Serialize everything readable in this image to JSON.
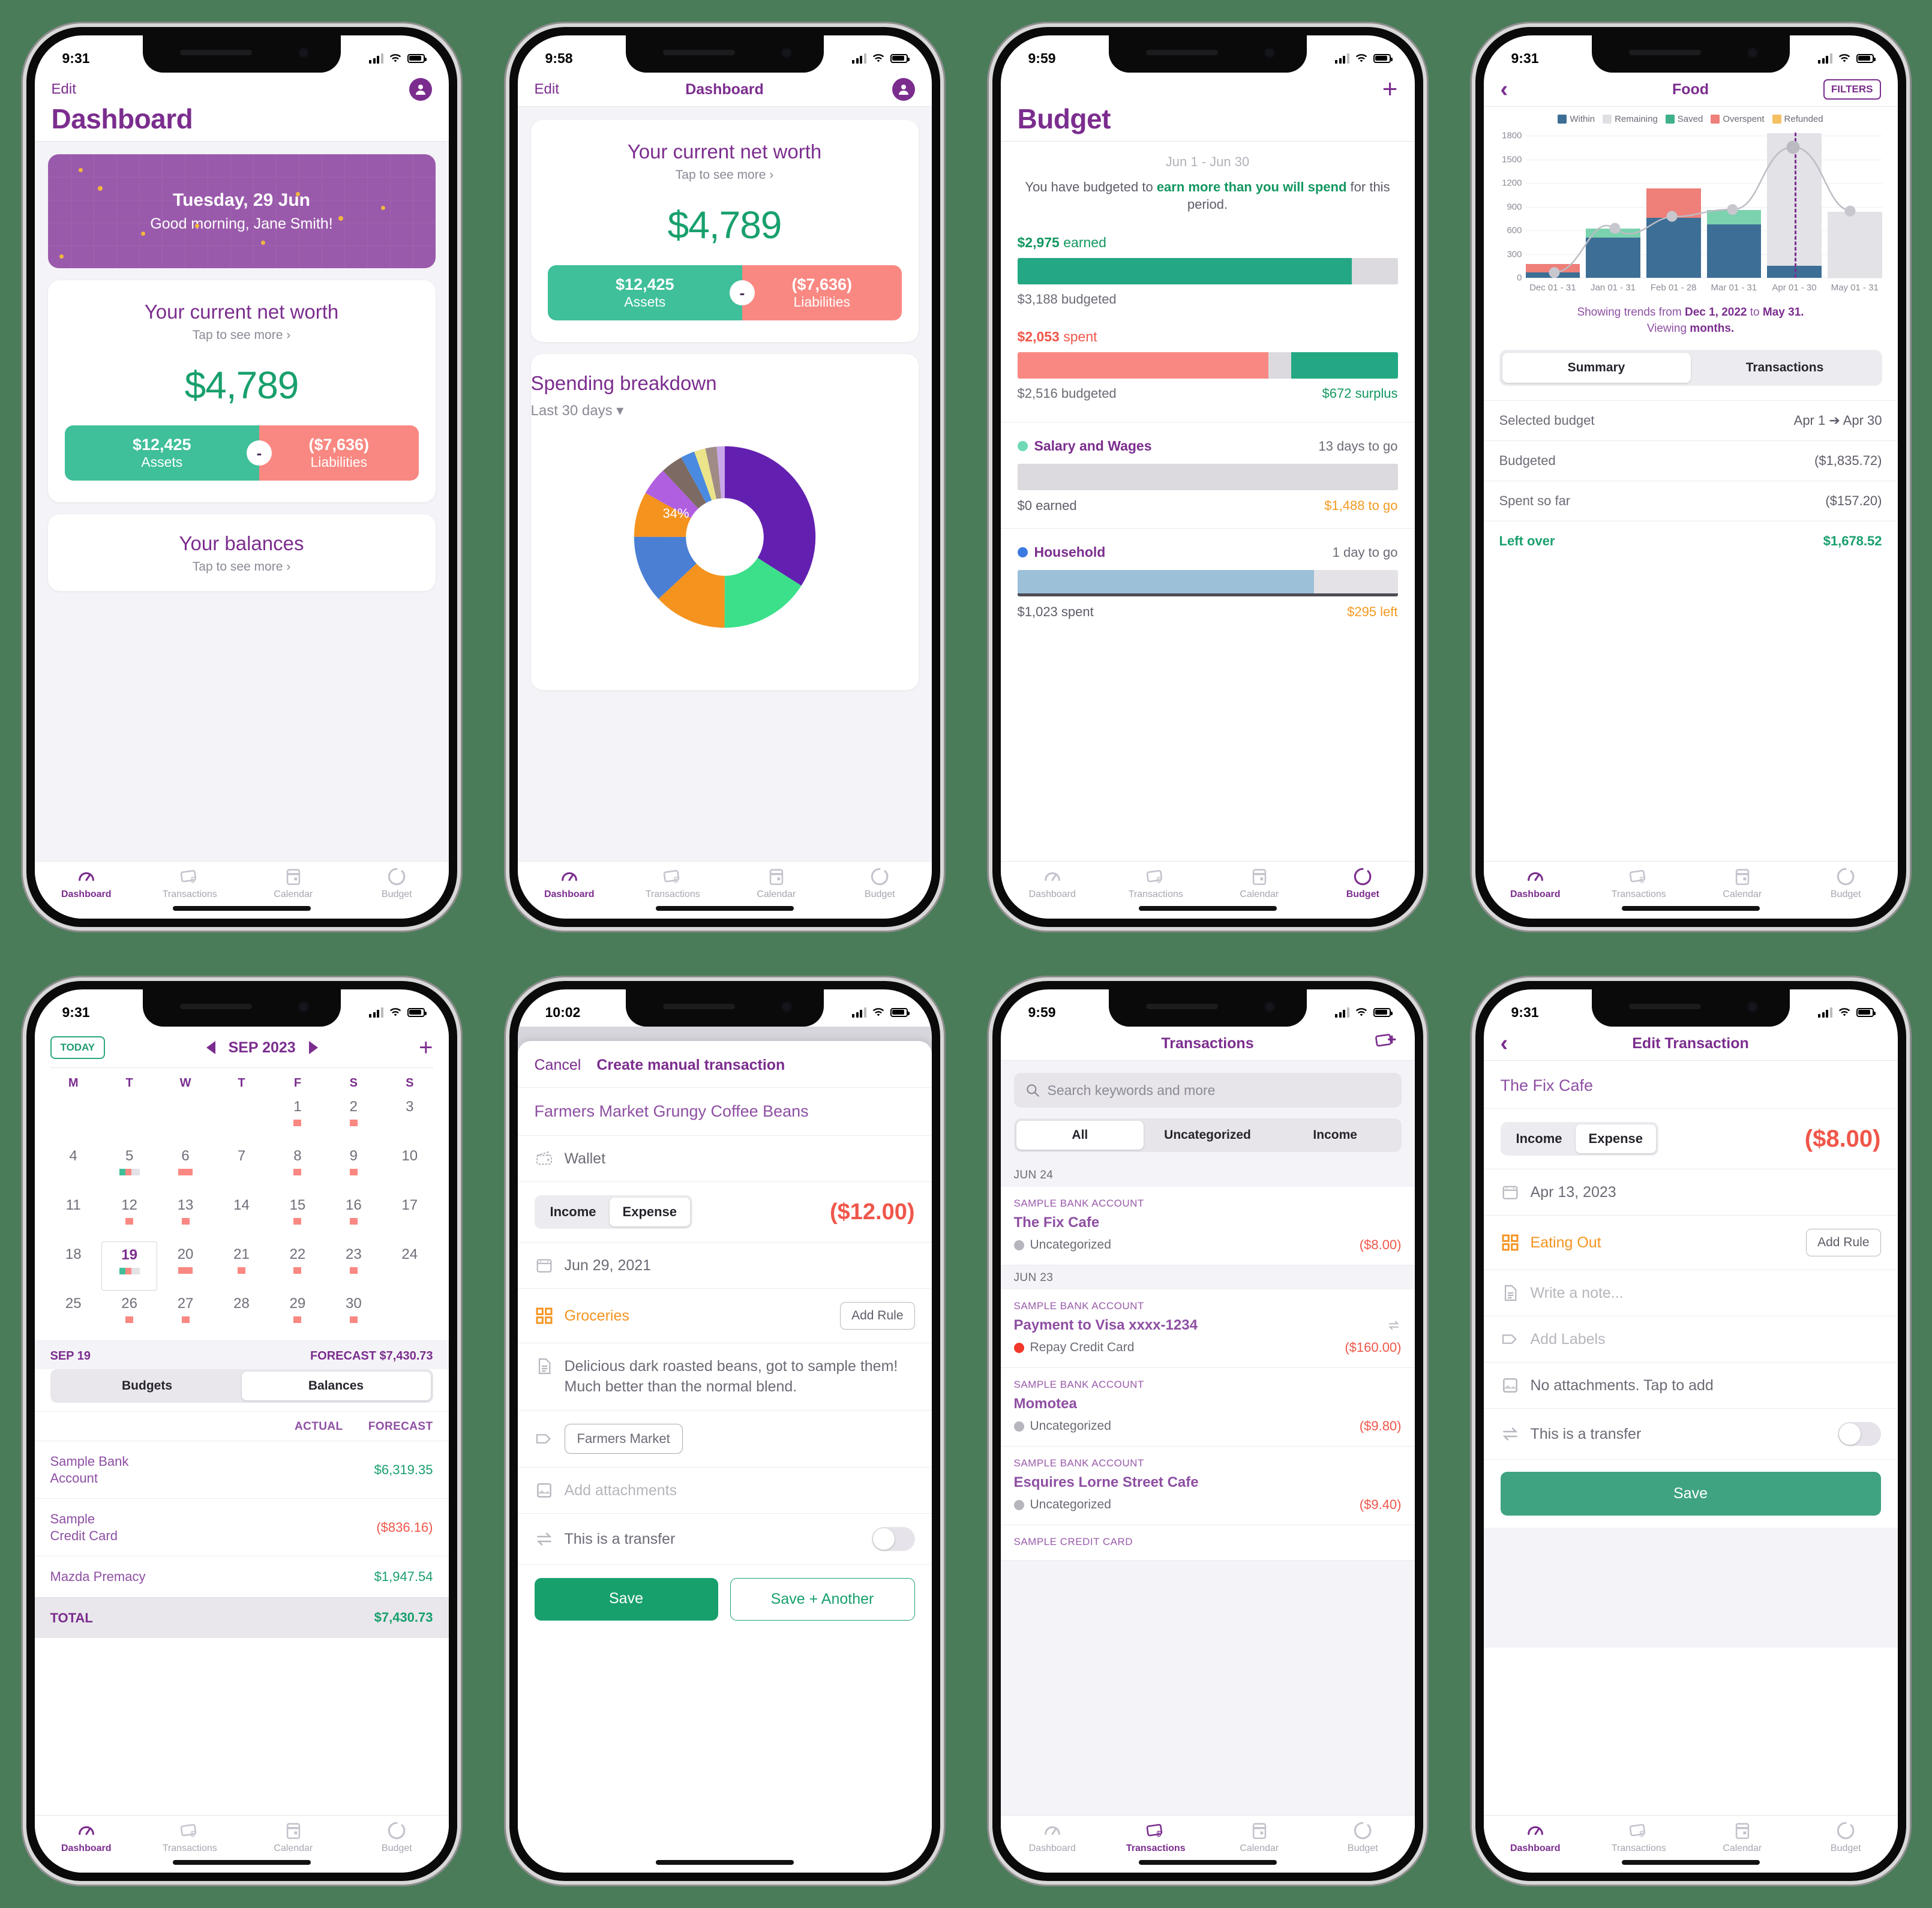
{
  "colors": {
    "purple": "#7b2d8e",
    "purple_light": "#9a5aab",
    "green": "#18a06c",
    "teal": "#3fbf9a",
    "red": "#f0564a",
    "salmon": "#f98882",
    "amber": "#f49a22",
    "orange": "#f5931f",
    "blue": "#4a7fd4",
    "steel": "#3d6e96"
  },
  "tabbar": {
    "items": [
      {
        "label": "Dashboard",
        "icon": "speedometer-icon"
      },
      {
        "label": "Transactions",
        "icon": "card-money-icon"
      },
      {
        "label": "Calendar",
        "icon": "calendar-icon"
      },
      {
        "label": "Budget",
        "icon": "donut-icon"
      }
    ]
  },
  "screen1": {
    "status": {
      "time": "9:31"
    },
    "nav": {
      "left": "Edit",
      "avatar": "avatar-icon"
    },
    "title": "Dashboard",
    "greeting": {
      "date": "Tuesday, 29 Jun",
      "message": "Good morning, Jane Smith!"
    },
    "networth": {
      "title": "Your current net worth",
      "subtitle": "Tap to see more ›",
      "amount": "$4,789",
      "assets_value": "$12,425",
      "assets_label": "Assets",
      "liabilities_value": "($7,636)",
      "liabilities_label": "Liabilities",
      "operator": "-"
    },
    "balances": {
      "title": "Your balances",
      "subtitle": "Tap to see more ›"
    },
    "active_tab": 0
  },
  "screen2": {
    "status": {
      "time": "9:58"
    },
    "nav": {
      "left": "Edit",
      "title": "Dashboard",
      "avatar": "avatar-icon"
    },
    "networth": {
      "title": "Your current net worth",
      "subtitle": "Tap to see more ›",
      "amount": "$4,789",
      "assets_value": "$12,425",
      "assets_label": "Assets",
      "liabilities_value": "($7,636)",
      "liabilities_label": "Liabilities",
      "operator": "-"
    },
    "spending": {
      "title": "Spending breakdown",
      "range": "Last 30 days ▾"
    },
    "active_tab": 0,
    "chart_data": {
      "type": "pie",
      "title": "Spending breakdown",
      "subtitle": "Last 30 days",
      "labels": [
        "34%",
        "13%",
        "12%",
        "8%",
        "5%",
        "",
        "",
        "",
        "",
        "",
        ""
      ],
      "values": [
        34,
        13,
        12,
        8,
        5,
        4,
        3,
        2,
        2,
        1,
        16
      ],
      "colors": [
        "#6320b0",
        "#f5931f",
        "#4a7fd4",
        "#f5931f",
        "#b05fe0",
        "#7d6a62",
        "#4a8ae0",
        "#ebe48a",
        "#a08b86",
        "#f0a860",
        "#3de08a"
      ],
      "legend": "none",
      "grid": false
    }
  },
  "screen3": {
    "status": {
      "time": "9:59"
    },
    "nav": {
      "right": "+"
    },
    "title": "Budget",
    "period": "Jun 1 - Jun 30",
    "message_pre": "You have budgeted to ",
    "message_bold": "earn more than you will spend",
    "message_post": " for this period.",
    "earned": {
      "label_amount": "$2,975",
      "label_word": " earned",
      "budgeted": "$3,188 budgeted",
      "pct": 88
    },
    "spent": {
      "label_amount": "$2,053",
      "label_word": " spent",
      "budgeted": "$2,516 budgeted",
      "surplus": "$672 surplus",
      "pct": 66,
      "surplus_pct": 28
    },
    "categories": [
      {
        "name": "Salary and Wages",
        "dot": "#6fd9b4",
        "days": "13 days to go",
        "progress": 0,
        "bar_color": "#dcdade",
        "left_text": "$0 earned",
        "right_text": "$1,488 to go",
        "right_amber": true
      },
      {
        "name": "Household",
        "dot": "#3b7ae0",
        "days": "1 day to go",
        "progress": 78,
        "bar_color": "#9cc0d8",
        "left_text": "$1,023 spent",
        "right_text": "$295 left",
        "right_amber": true
      }
    ],
    "active_tab": 3
  },
  "screen4": {
    "status": {
      "time": "9:31"
    },
    "nav": {
      "back": "‹",
      "title": "Food",
      "filters": "FILTERS"
    },
    "trend_pre": "Showing trends from ",
    "trend_b1": "Dec 1, 2022",
    "trend_mid": " to ",
    "trend_b2": "May 31.",
    "trend_post2": "Viewing ",
    "trend_b3": "months.",
    "segments": [
      {
        "label": "Summary",
        "active": true
      },
      {
        "label": "Transactions",
        "active": false
      }
    ],
    "summary_rows": [
      {
        "key": "Selected budget",
        "value": "Apr 1 ➔ Apr 30",
        "highlight": false
      },
      {
        "key": "Budgeted",
        "value": "($1,835.72)",
        "highlight": false
      },
      {
        "key": "Spent so far",
        "value": "($157.20)",
        "highlight": false
      },
      {
        "key": "Left over",
        "value": "$1,678.52",
        "highlight": true
      }
    ],
    "active_tab": 0,
    "chart_data": {
      "type": "bar",
      "title": "Food",
      "categories": [
        "Dec 01 - 31",
        "Jan 01 - 31",
        "Feb 01 - 28",
        "Mar 01 - 31",
        "Apr 01 - 30",
        "May 01 - 31"
      ],
      "ylim": [
        0,
        1900
      ],
      "yticks": [
        0,
        300,
        600,
        900,
        1200,
        1500,
        1800
      ],
      "grid": true,
      "legend_position": "top",
      "legend": [
        "Within",
        "Remaining",
        "Saved",
        "Overspent",
        "Refunded"
      ],
      "legend_colors": [
        "#3d6e96",
        "#dfdfe4",
        "#3fb08a",
        "#ee7f79",
        "#f4c064"
      ],
      "series": [
        {
          "name": "Within",
          "values": [
            70,
            510,
            760,
            680,
            150,
            0
          ]
        },
        {
          "name": "Remaining",
          "values": [
            0,
            0,
            0,
            0,
            1680,
            840
          ]
        },
        {
          "name": "Saved",
          "values": [
            0,
            115,
            0,
            180,
            0,
            0
          ]
        },
        {
          "name": "Overspent",
          "values": [
            105,
            0,
            370,
            0,
            0,
            0
          ]
        },
        {
          "name": "Refunded",
          "values": [
            0,
            0,
            0,
            0,
            0,
            0
          ]
        }
      ],
      "line_series": {
        "name": "Trend",
        "values": [
          70,
          625,
          775,
          865,
          1830,
          845
        ]
      },
      "marker_line_index": 4
    }
  },
  "screen5": {
    "status": {
      "time": "9:31"
    },
    "today_button": "TODAY",
    "month": "SEP 2023",
    "add": "+",
    "dow": [
      "M",
      "T",
      "W",
      "T",
      "F",
      "S",
      "S"
    ],
    "weeks": [
      [
        {
          "n": ""
        },
        {
          "n": ""
        },
        {
          "n": ""
        },
        {
          "n": ""
        },
        {
          "n": "1",
          "mark": "red"
        },
        {
          "n": "2",
          "mark": "red"
        },
        {
          "n": "3"
        }
      ],
      [
        {
          "n": "4"
        },
        {
          "n": "5",
          "mark": "split"
        },
        {
          "n": "6",
          "mark": "redwide"
        },
        {
          "n": "7"
        },
        {
          "n": "8",
          "mark": "red"
        },
        {
          "n": "9",
          "mark": "red"
        },
        {
          "n": "10"
        }
      ],
      [
        {
          "n": "11"
        },
        {
          "n": "12",
          "mark": "red"
        },
        {
          "n": "13",
          "mark": "red"
        },
        {
          "n": "14"
        },
        {
          "n": "15",
          "mark": "red"
        },
        {
          "n": "16",
          "mark": "red"
        },
        {
          "n": "17"
        }
      ],
      [
        {
          "n": "18"
        },
        {
          "n": "19",
          "mark": "split",
          "selected": true
        },
        {
          "n": "20",
          "mark": "redwide"
        },
        {
          "n": "21",
          "mark": "red"
        },
        {
          "n": "22",
          "mark": "red"
        },
        {
          "n": "23",
          "mark": "red"
        },
        {
          "n": "24"
        }
      ],
      [
        {
          "n": "25"
        },
        {
          "n": "26",
          "mark": "red"
        },
        {
          "n": "27",
          "mark": "red"
        },
        {
          "n": "28"
        },
        {
          "n": "29",
          "mark": "red"
        },
        {
          "n": "30",
          "mark": "red"
        },
        {
          "n": ""
        }
      ]
    ],
    "summary_date": "SEP 19",
    "summary_forecast": "FORECAST $7,430.73",
    "segments": [
      {
        "label": "Budgets",
        "active": false
      },
      {
        "label": "Balances",
        "active": true
      }
    ],
    "table_headers": {
      "actual": "ACTUAL",
      "forecast": "FORECAST"
    },
    "table_rows": [
      {
        "name": "Sample Bank\nAccount",
        "actual": "",
        "forecast": "$6,319.35",
        "negative": false
      },
      {
        "name": "Sample\nCredit Card",
        "actual": "",
        "forecast": "($836.16)",
        "negative": true
      },
      {
        "name": "Mazda Premacy",
        "actual": "",
        "forecast": "$1,947.54",
        "negative": false
      }
    ],
    "total": {
      "label": "TOTAL",
      "value": "$7,430.73"
    },
    "active_tab": 0
  },
  "screen6": {
    "status": {
      "time": "10:02"
    },
    "sheet": {
      "cancel": "Cancel",
      "title": "Create manual transaction"
    },
    "merchant": "Farmers Market Grungy Coffee Beans",
    "account": "Wallet",
    "income_label": "Income",
    "expense_label": "Expense",
    "amount": "($12.00)",
    "date": "Jun 29, 2021",
    "category": "Groceries",
    "add_rule": "Add Rule",
    "note": "Delicious dark roasted beans, got to sample them! Much better than the normal blend.",
    "label_chip": "Farmers Market",
    "attachments": "Add attachments",
    "transfer": "This is a transfer",
    "save": "Save",
    "save_another": "Save + Another"
  },
  "screen7": {
    "status": {
      "time": "9:59"
    },
    "nav": {
      "title": "Transactions",
      "add_icon": "add-transaction-icon"
    },
    "search_placeholder": "Search keywords and more",
    "filters": [
      {
        "label": "All",
        "active": true
      },
      {
        "label": "Uncategorized",
        "active": false
      },
      {
        "label": "Income",
        "active": false
      }
    ],
    "groups": [
      {
        "date": "JUN 24",
        "items": [
          {
            "account": "SAMPLE BANK ACCOUNT",
            "name": "The Fix Cafe",
            "category": "Uncategorized",
            "dot": "#b7b5bd",
            "amount": "($8.00)",
            "transfer": false
          }
        ]
      },
      {
        "date": "JUN 23",
        "items": [
          {
            "account": "SAMPLE BANK ACCOUNT",
            "name": "Payment to Visa xxxx-1234",
            "category": "Repay Credit Card",
            "dot": "#f0372a",
            "amount": "($160.00)",
            "transfer": true
          },
          {
            "account": "SAMPLE BANK ACCOUNT",
            "name": "Momotea",
            "category": "Uncategorized",
            "dot": "#b7b5bd",
            "amount": "($9.80)",
            "transfer": false
          },
          {
            "account": "SAMPLE BANK ACCOUNT",
            "name": "Esquires Lorne Street Cafe",
            "category": "Uncategorized",
            "dot": "#b7b5bd",
            "amount": "($9.40)",
            "transfer": false
          },
          {
            "account": "SAMPLE CREDIT CARD",
            "name": "",
            "category": "",
            "dot": "#b7b5bd",
            "amount": "",
            "transfer": false
          }
        ]
      }
    ],
    "active_tab": 1
  },
  "screen8": {
    "status": {
      "time": "9:31"
    },
    "nav": {
      "back": "‹",
      "title": "Edit Transaction"
    },
    "merchant": "The Fix Cafe",
    "income_label": "Income",
    "expense_label": "Expense",
    "amount": "($8.00)",
    "date": "Apr 13, 2023",
    "category": "Eating Out",
    "add_rule": "Add Rule",
    "note_placeholder": "Write a note...",
    "labels_placeholder": "Add Labels",
    "attachments": "No attachments. Tap to add",
    "transfer": "This is a transfer",
    "save": "Save",
    "active_tab": 0
  }
}
